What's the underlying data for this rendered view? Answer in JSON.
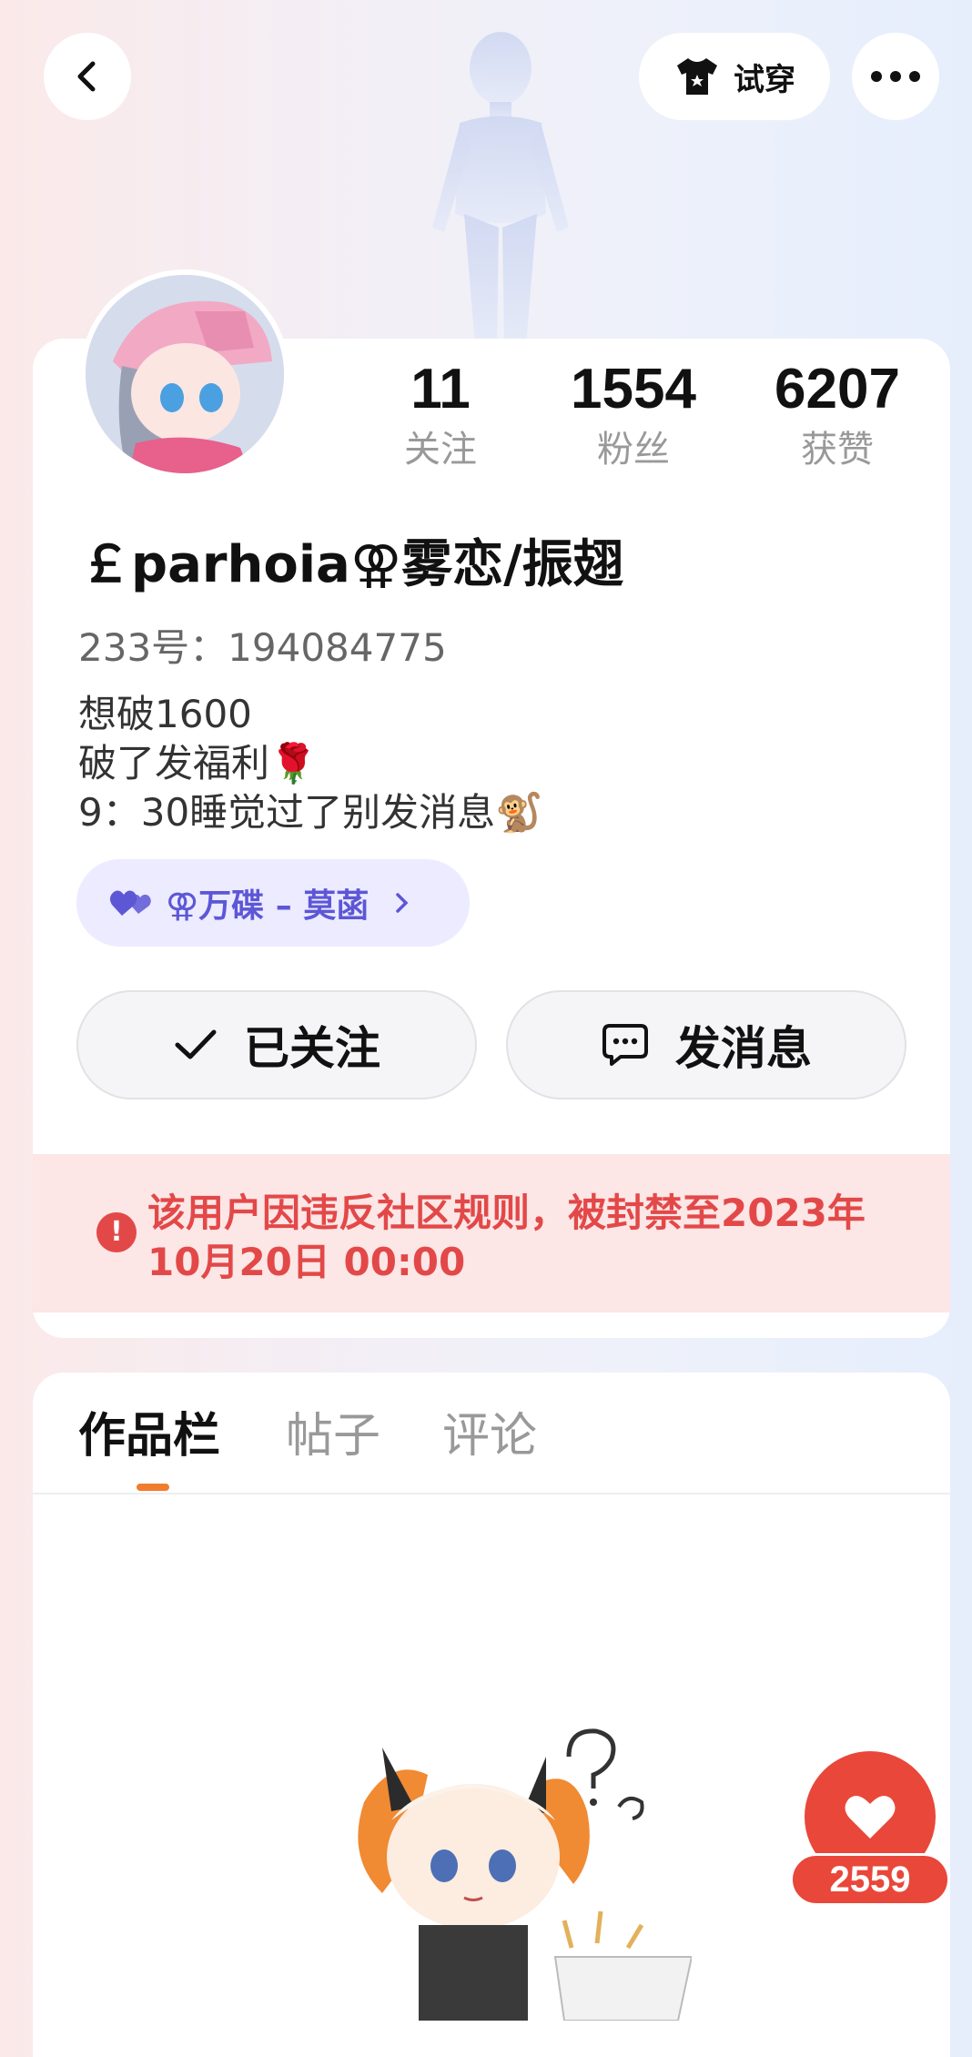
{
  "header": {
    "try_on_label": "试穿",
    "icons": {
      "back": "chevron-left-icon",
      "try_on": "shirt-icon",
      "more": "more-dots-icon"
    }
  },
  "profile": {
    "stats": [
      {
        "value": "11",
        "label": "关注"
      },
      {
        "value": "1554",
        "label": "粉丝"
      },
      {
        "value": "6207",
        "label": "获赞"
      }
    ],
    "username": "￡parhoia⚢雾恋/振翅",
    "uid": "233号：194084775",
    "bio_lines": [
      "想破1600",
      "破了发福利🌹",
      "9：30睡觉过了别发消息🐒"
    ],
    "club_tag": "⚢万碟 – 莫菡",
    "follow_button": "已关注",
    "message_button": "发消息",
    "ban_notice": "该用户因违反社区规则，被封禁至2023年10月20日 00:00"
  },
  "tabs": [
    {
      "label": "作品栏",
      "active": true
    },
    {
      "label": "帖子",
      "active": false
    },
    {
      "label": "评论",
      "active": false
    }
  ],
  "like_fab": {
    "count": "2559"
  },
  "colors": {
    "accent_orange": "#ef7d2d",
    "ban_red": "#e34848",
    "ban_bg": "#fce6e6",
    "club_purple": "#5d57d6",
    "like_red": "#e9473a"
  }
}
